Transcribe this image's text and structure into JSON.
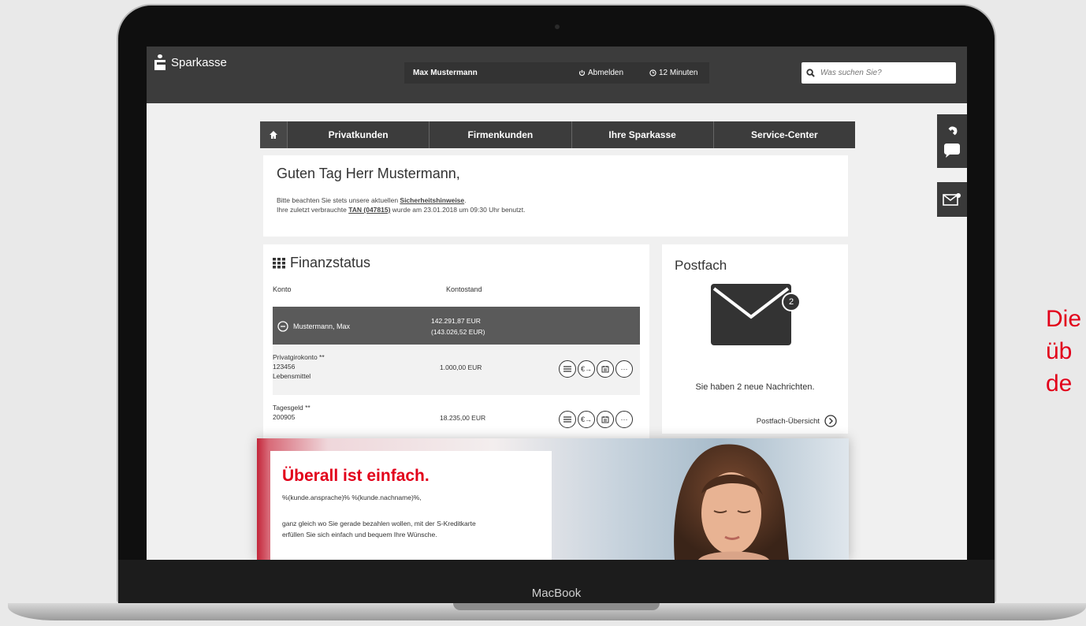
{
  "device": {
    "label": "MacBook"
  },
  "header": {
    "brand": "Sparkasse",
    "user_name": "Max Mustermann",
    "logout_label": "Abmelden",
    "session_timer": "12 Minuten",
    "search_placeholder": "Was suchen Sie?"
  },
  "nav": {
    "items": [
      {
        "label": "Privatkunden"
      },
      {
        "label": "Firmenkunden"
      },
      {
        "label": "Ihre Sparkasse"
      },
      {
        "label": "Service-Center"
      }
    ]
  },
  "greeting": {
    "title": "Guten Tag Herr Mustermann,",
    "line1_prefix": "Bitte beachten Sie stets unsere aktuellen ",
    "line1_link": "Sicherheitshinweise",
    "line1_suffix": ".",
    "line2_prefix": "Ihre zuletzt verbrauchte ",
    "line2_tan": "TAN (047815)",
    "line2_suffix": " wurde am 23.01.2018 um 09:30 Uhr benutzt."
  },
  "finanzstatus": {
    "title": "Finanzstatus",
    "col_konto": "Konto",
    "col_kontostand": "Kontostand",
    "owner": {
      "name": "Mustermann, Max",
      "balance": "142.291,87 EUR",
      "balance_secondary": "(143.026,52 EUR)"
    },
    "accounts": [
      {
        "type": "Privatgirokonto **",
        "number": "123456",
        "note": "Lebensmittel",
        "balance": "1.000,00 EUR"
      },
      {
        "type": "Tagesgeld **",
        "number": "200905",
        "note": "",
        "balance": "18.235,00 EUR"
      }
    ]
  },
  "postfach": {
    "title": "Postfach",
    "unread_count": "2",
    "message": "Sie haben 2 neue Nachrichten.",
    "overview_link": "Postfach-Übersicht"
  },
  "promo": {
    "title": "Überall ist einfach.",
    "salutation": "%(kunde.ansprache)% %(kunde.nachname)%,",
    "body_line1": "ganz gleich wo Sie gerade bezahlen wollen, mit der S-Kreditkarte",
    "body_line2": "erfüllen Sie sich einfach und bequem Ihre Wünsche."
  },
  "caption": {
    "line1": "Die",
    "line2": "üb",
    "line3": "de"
  },
  "colors": {
    "brand_red": "#e2001a",
    "header_dark": "#3c3c3c",
    "owner_row": "#5a5a5a"
  }
}
